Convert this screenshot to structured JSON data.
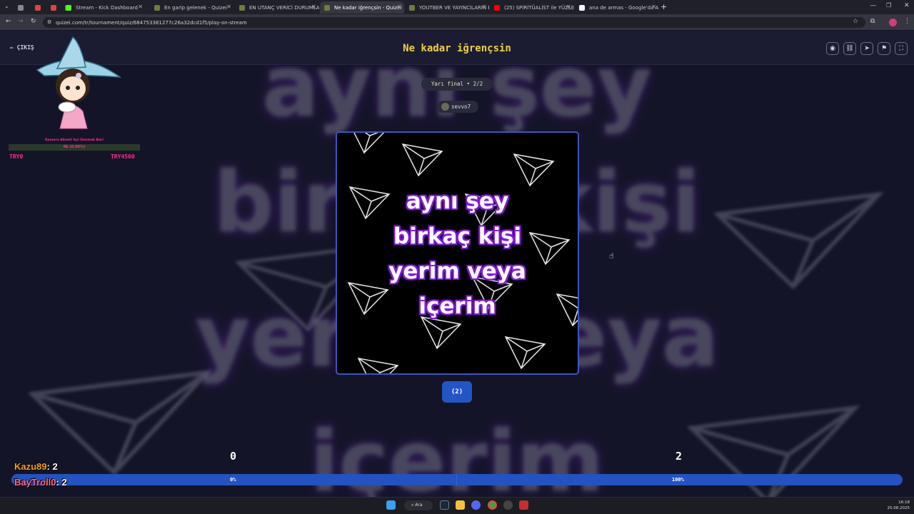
{
  "browser": {
    "tabs": [
      {
        "label": "",
        "fav": "#888"
      },
      {
        "label": "",
        "fav": "#d44"
      },
      {
        "label": "",
        "fav": "#d44"
      },
      {
        "label": "",
        "fav": "#c13584"
      },
      {
        "label": "Stream - Kick Dashboard",
        "fav": "#53fc18"
      },
      {
        "label": "En garip gelenek - Quizei",
        "fav": "#6a7f3a"
      },
      {
        "label": "EN UTANÇ VERİCİ DURUMLAR",
        "fav": "#6a7f3a"
      },
      {
        "label": "Ne kadar iğrençsin - Quizei",
        "fav": "#6a7f3a"
      },
      {
        "label": "YOUTBER VE YAYINCILARIN EN",
        "fav": "#6a7f3a"
      },
      {
        "label": "(25) SPİRİTÜALİST ile YÜZLEŞM",
        "fav": "#ff0000"
      },
      {
        "label": "ana de armas - Google'da Ara",
        "fav": "#ffffff"
      }
    ],
    "url": "quizei.com/tr/tournament/quiz/684753381277c26a32dcd1f5/play-on-stream",
    "new_tab": "+"
  },
  "app": {
    "title": "Ne kadar iğrençsin",
    "exit_label": "ÇIKIŞ",
    "round": "Yarı final • 2/2",
    "username": "sevvo7",
    "card_lines": [
      "aynı şey",
      "birkaç kişi",
      "yerim veya",
      "içerim"
    ],
    "vote_label": "(2)",
    "left_score": "0",
    "right_score": "2",
    "left_pct_value": 0,
    "left_pct": "0%",
    "right_pct": "100%",
    "bg_words": [
      "aynı şey",
      "birkaç kişi",
      "yerim veya",
      "içerim"
    ]
  },
  "overlay": {
    "donation_title": "Kamera Ahmet İşçi Danmak Bari",
    "donation_amount": "0₺ (0.00%)",
    "donation_progress": 0,
    "donation_min": "TRY0",
    "donation_max": "TRY4500",
    "leaderboard": [
      {
        "name": "Kazu89",
        "score": ": 2",
        "color": "#f5a21c"
      },
      {
        "name": "BayTroll0",
        "score": ": 2",
        "color": "#ff6b8e"
      }
    ]
  },
  "taskbar": {
    "search_label": "Ara",
    "time": "16:18",
    "date": "25.08.2025"
  },
  "colors": {
    "accent_title": "#f1d046",
    "vote_blue": "#2455c4",
    "text_glow": "#8a1fe0"
  }
}
